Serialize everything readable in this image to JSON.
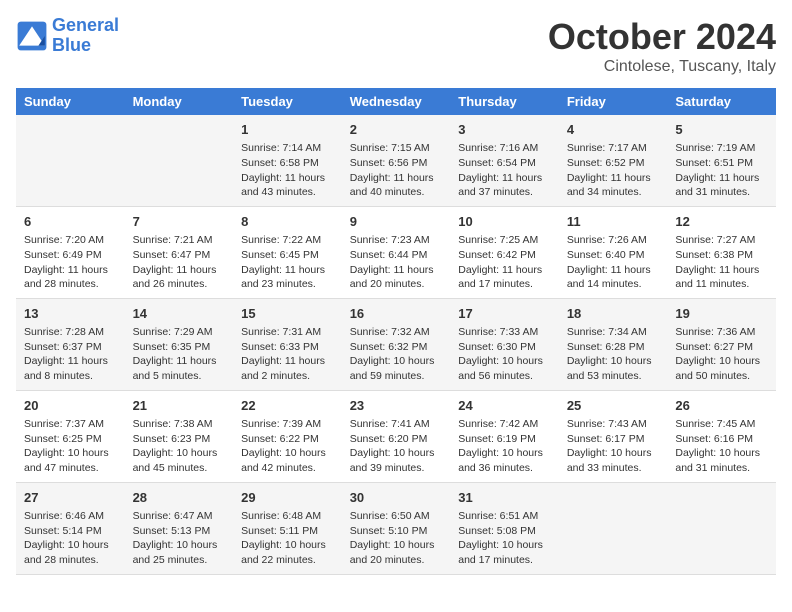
{
  "header": {
    "logo_line1": "General",
    "logo_line2": "Blue",
    "month": "October 2024",
    "location": "Cintolese, Tuscany, Italy"
  },
  "days_of_week": [
    "Sunday",
    "Monday",
    "Tuesday",
    "Wednesday",
    "Thursday",
    "Friday",
    "Saturday"
  ],
  "weeks": [
    [
      {
        "day": "",
        "content": ""
      },
      {
        "day": "",
        "content": ""
      },
      {
        "day": "1",
        "content": "Sunrise: 7:14 AM\nSunset: 6:58 PM\nDaylight: 11 hours and 43 minutes."
      },
      {
        "day": "2",
        "content": "Sunrise: 7:15 AM\nSunset: 6:56 PM\nDaylight: 11 hours and 40 minutes."
      },
      {
        "day": "3",
        "content": "Sunrise: 7:16 AM\nSunset: 6:54 PM\nDaylight: 11 hours and 37 minutes."
      },
      {
        "day": "4",
        "content": "Sunrise: 7:17 AM\nSunset: 6:52 PM\nDaylight: 11 hours and 34 minutes."
      },
      {
        "day": "5",
        "content": "Sunrise: 7:19 AM\nSunset: 6:51 PM\nDaylight: 11 hours and 31 minutes."
      }
    ],
    [
      {
        "day": "6",
        "content": "Sunrise: 7:20 AM\nSunset: 6:49 PM\nDaylight: 11 hours and 28 minutes."
      },
      {
        "day": "7",
        "content": "Sunrise: 7:21 AM\nSunset: 6:47 PM\nDaylight: 11 hours and 26 minutes."
      },
      {
        "day": "8",
        "content": "Sunrise: 7:22 AM\nSunset: 6:45 PM\nDaylight: 11 hours and 23 minutes."
      },
      {
        "day": "9",
        "content": "Sunrise: 7:23 AM\nSunset: 6:44 PM\nDaylight: 11 hours and 20 minutes."
      },
      {
        "day": "10",
        "content": "Sunrise: 7:25 AM\nSunset: 6:42 PM\nDaylight: 11 hours and 17 minutes."
      },
      {
        "day": "11",
        "content": "Sunrise: 7:26 AM\nSunset: 6:40 PM\nDaylight: 11 hours and 14 minutes."
      },
      {
        "day": "12",
        "content": "Sunrise: 7:27 AM\nSunset: 6:38 PM\nDaylight: 11 hours and 11 minutes."
      }
    ],
    [
      {
        "day": "13",
        "content": "Sunrise: 7:28 AM\nSunset: 6:37 PM\nDaylight: 11 hours and 8 minutes."
      },
      {
        "day": "14",
        "content": "Sunrise: 7:29 AM\nSunset: 6:35 PM\nDaylight: 11 hours and 5 minutes."
      },
      {
        "day": "15",
        "content": "Sunrise: 7:31 AM\nSunset: 6:33 PM\nDaylight: 11 hours and 2 minutes."
      },
      {
        "day": "16",
        "content": "Sunrise: 7:32 AM\nSunset: 6:32 PM\nDaylight: 10 hours and 59 minutes."
      },
      {
        "day": "17",
        "content": "Sunrise: 7:33 AM\nSunset: 6:30 PM\nDaylight: 10 hours and 56 minutes."
      },
      {
        "day": "18",
        "content": "Sunrise: 7:34 AM\nSunset: 6:28 PM\nDaylight: 10 hours and 53 minutes."
      },
      {
        "day": "19",
        "content": "Sunrise: 7:36 AM\nSunset: 6:27 PM\nDaylight: 10 hours and 50 minutes."
      }
    ],
    [
      {
        "day": "20",
        "content": "Sunrise: 7:37 AM\nSunset: 6:25 PM\nDaylight: 10 hours and 47 minutes."
      },
      {
        "day": "21",
        "content": "Sunrise: 7:38 AM\nSunset: 6:23 PM\nDaylight: 10 hours and 45 minutes."
      },
      {
        "day": "22",
        "content": "Sunrise: 7:39 AM\nSunset: 6:22 PM\nDaylight: 10 hours and 42 minutes."
      },
      {
        "day": "23",
        "content": "Sunrise: 7:41 AM\nSunset: 6:20 PM\nDaylight: 10 hours and 39 minutes."
      },
      {
        "day": "24",
        "content": "Sunrise: 7:42 AM\nSunset: 6:19 PM\nDaylight: 10 hours and 36 minutes."
      },
      {
        "day": "25",
        "content": "Sunrise: 7:43 AM\nSunset: 6:17 PM\nDaylight: 10 hours and 33 minutes."
      },
      {
        "day": "26",
        "content": "Sunrise: 7:45 AM\nSunset: 6:16 PM\nDaylight: 10 hours and 31 minutes."
      }
    ],
    [
      {
        "day": "27",
        "content": "Sunrise: 6:46 AM\nSunset: 5:14 PM\nDaylight: 10 hours and 28 minutes."
      },
      {
        "day": "28",
        "content": "Sunrise: 6:47 AM\nSunset: 5:13 PM\nDaylight: 10 hours and 25 minutes."
      },
      {
        "day": "29",
        "content": "Sunrise: 6:48 AM\nSunset: 5:11 PM\nDaylight: 10 hours and 22 minutes."
      },
      {
        "day": "30",
        "content": "Sunrise: 6:50 AM\nSunset: 5:10 PM\nDaylight: 10 hours and 20 minutes."
      },
      {
        "day": "31",
        "content": "Sunrise: 6:51 AM\nSunset: 5:08 PM\nDaylight: 10 hours and 17 minutes."
      },
      {
        "day": "",
        "content": ""
      },
      {
        "day": "",
        "content": ""
      }
    ]
  ]
}
